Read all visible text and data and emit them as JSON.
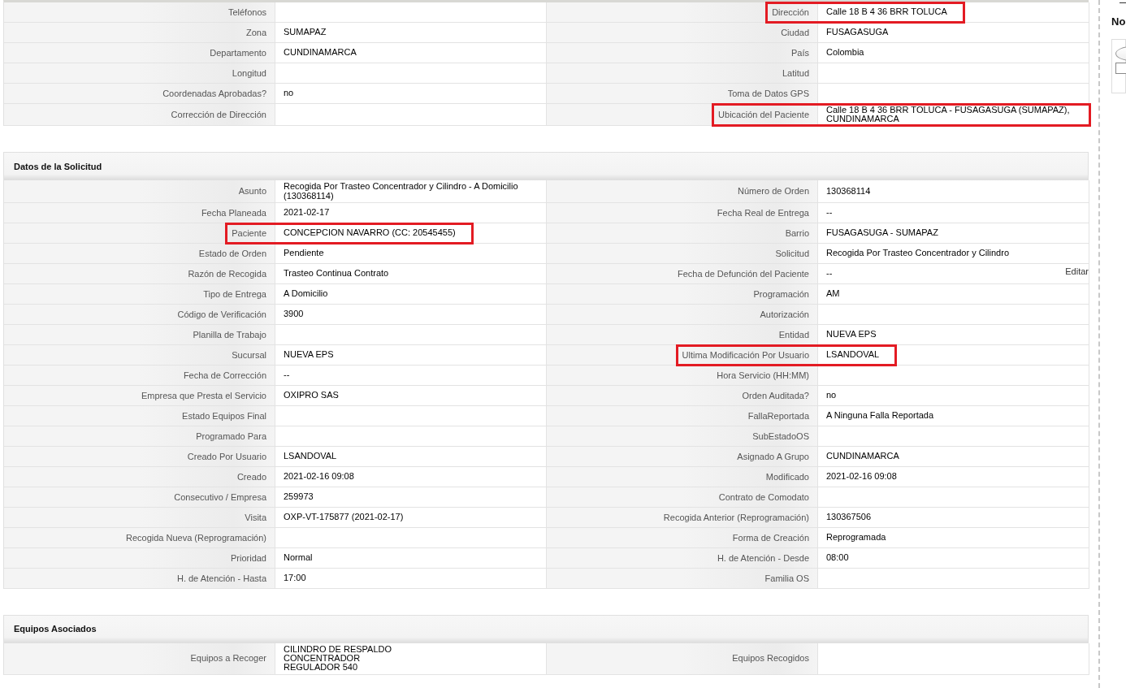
{
  "sections": [
    {
      "rows": [
        [
          {
            "label": "Teléfonos",
            "highlighted": false
          },
          {
            "label": "Dirección",
            "value": "Calle 18 B 4 36 BRR TOLUCA",
            "highlighted": true
          }
        ],
        [
          {
            "label": "Zona",
            "value": "SUMAPAZ",
            "highlighted": false
          },
          {
            "label": "Ciudad",
            "value": "FUSAGASUGA",
            "highlighted": false
          }
        ],
        [
          {
            "label": "Departamento",
            "value": "CUNDINAMARCA",
            "highlighted": false
          },
          {
            "label": "País",
            "value": "Colombia",
            "highlighted": false
          }
        ],
        [
          {
            "label": "Longitud",
            "highlighted": false
          },
          {
            "label": "Latitud",
            "highlighted": false
          }
        ],
        [
          {
            "label": "Coordenadas Aprobadas?",
            "value": "no",
            "highlighted": false
          },
          {
            "label": "Toma de Datos GPS",
            "highlighted": false
          }
        ],
        [
          {
            "label": "Corrección de Dirección",
            "highlighted": false
          },
          {
            "label": "Ubicación del Paciente",
            "value": "Calle 18 B 4 36 BRR TOLUCA - FUSAGASUGA (SUMAPAZ), CUNDINAMARCA",
            "highlighted": true
          }
        ]
      ]
    },
    {
      "title": "Datos de la Solicitud",
      "rows": [
        [
          {
            "label": "Asunto",
            "value": "Recogida Por Trasteo Concentrador y Cilindro - A Domicilio (130368114)",
            "highlighted": false
          },
          {
            "label": "Número de Orden",
            "value": "130368114",
            "highlighted": false
          }
        ],
        [
          {
            "label": "Fecha Planeada",
            "value": "2021-02-17",
            "highlighted": false
          },
          {
            "label": "Fecha Real de Entrega",
            "value": "--",
            "highlighted": false
          }
        ],
        [
          {
            "label": "Paciente",
            "value": "CONCEPCION NAVARRO (CC: 20545455)",
            "highlighted": true
          },
          {
            "label": "Barrio",
            "value": "FUSAGASUGA - SUMAPAZ",
            "highlighted": false
          }
        ],
        [
          {
            "label": "Estado de Orden",
            "value": "Pendiente",
            "highlighted": false
          },
          {
            "label": "Solicitud",
            "value": "Recogida Por Trasteo Concentrador y Cilindro",
            "highlighted": false
          }
        ],
        [
          {
            "label": "Razón de Recogida",
            "value": "Trasteo Continua Contrato",
            "highlighted": false
          },
          {
            "label": "Fecha de Defunción del Paciente",
            "value": "--",
            "highlighted": false,
            "edit_link": "Editar"
          }
        ],
        [
          {
            "label": "Tipo de Entrega",
            "value": "A Domicilio",
            "highlighted": false
          },
          {
            "label": "Programación",
            "value": "AM",
            "highlighted": false
          }
        ],
        [
          {
            "label": "Código de Verificación",
            "value": "3900",
            "highlighted": false
          },
          {
            "label": "Autorización",
            "highlighted": false
          }
        ],
        [
          {
            "label": "Planilla de Trabajo",
            "highlighted": false
          },
          {
            "label": "Entidad",
            "value": "NUEVA EPS",
            "highlighted": false
          }
        ],
        [
          {
            "label": "Sucursal",
            "value": "NUEVA EPS",
            "highlighted": false
          },
          {
            "label": "Ultima Modificación Por Usuario",
            "value": "LSANDOVAL",
            "highlighted": true
          }
        ],
        [
          {
            "label": "Fecha de Corrección",
            "value": "--",
            "highlighted": false
          },
          {
            "label": "Hora Servicio (HH:MM)",
            "highlighted": false
          }
        ],
        [
          {
            "label": "Empresa que Presta el Servicio",
            "value": "OXIPRO SAS",
            "highlighted": false
          },
          {
            "label": "Orden Auditada?",
            "value": "no",
            "highlighted": false
          }
        ],
        [
          {
            "label": "Estado Equipos Final",
            "highlighted": false
          },
          {
            "label": "FallaReportada",
            "value": "A Ninguna Falla Reportada",
            "highlighted": false
          }
        ],
        [
          {
            "label": "Programado Para",
            "highlighted": false
          },
          {
            "label": "SubEstadoOS",
            "highlighted": false
          }
        ],
        [
          {
            "label": "Creado Por Usuario",
            "value": "LSANDOVAL",
            "highlighted": false
          },
          {
            "label": "Asignado A Grupo",
            "value": "CUNDINAMARCA",
            "highlighted": false
          }
        ],
        [
          {
            "label": "Creado",
            "value": "2021-02-16 09:08",
            "highlighted": false
          },
          {
            "label": "Modificado",
            "value": "2021-02-16 09:08",
            "highlighted": false
          }
        ],
        [
          {
            "label": "Consecutivo / Empresa",
            "value": "259973",
            "highlighted": false
          },
          {
            "label": "Contrato de Comodato",
            "highlighted": false
          }
        ],
        [
          {
            "label": "Visita",
            "value": "OXP-VT-175877 (2021-02-17)",
            "highlighted": false
          },
          {
            "label": "Recogida Anterior (Reprogramación)",
            "value": "130367506",
            "highlighted": false
          }
        ],
        [
          {
            "label": "Recogida Nueva (Reprogramación)",
            "highlighted": false
          },
          {
            "label": "Forma de Creación",
            "value": "Reprogramada",
            "highlighted": false
          }
        ],
        [
          {
            "label": "Prioridad",
            "value": "Normal",
            "highlighted": false
          },
          {
            "label": "H. de Atención - Desde",
            "value": "08:00",
            "highlighted": false
          }
        ],
        [
          {
            "label": "H. de Atención - Hasta",
            "value": "17:00",
            "highlighted": false
          },
          {
            "label": "Familia OS",
            "highlighted": false
          }
        ]
      ]
    },
    {
      "title": "Equipos Asociados",
      "rows": [
        [
          {
            "label": "Equipos a Recoger",
            "value": "CILINDRO DE RESPALDO\nCONCENTRADOR\nREGULADOR 540",
            "highlighted": false
          },
          {
            "label": "Equipos Recogidos",
            "highlighted": false
          }
        ]
      ]
    }
  ],
  "side_panel": {
    "title": "No",
    "checkbox": {
      "checked": false
    }
  }
}
